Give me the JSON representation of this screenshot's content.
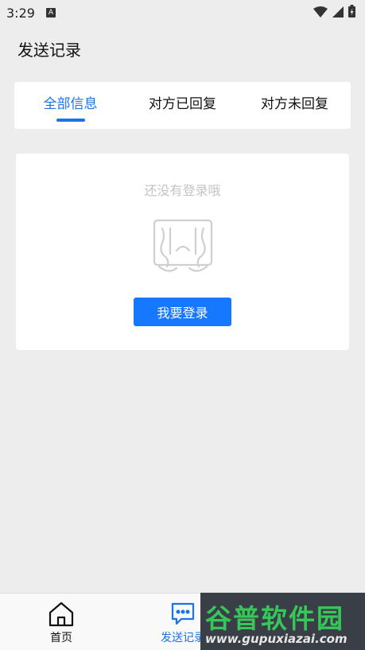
{
  "status_bar": {
    "time": "3:29",
    "notification_glyph": "A",
    "icons": [
      "wifi-icon",
      "cell-signal-icon",
      "battery-icon"
    ]
  },
  "header": {
    "title": "发送记录"
  },
  "tabs": [
    {
      "label": "全部信息",
      "active": true
    },
    {
      "label": "对方已回复",
      "active": false
    },
    {
      "label": "对方未回复",
      "active": false
    }
  ],
  "empty_state": {
    "message": "还没有登录哦",
    "illustration": "crying-face-icon",
    "button_label": "我要登录"
  },
  "bottom_nav": {
    "items": [
      {
        "label": "首页",
        "icon": "home-icon",
        "active": false
      },
      {
        "label": "发送记录",
        "icon": "message-icon",
        "active": true
      }
    ]
  },
  "watermark": {
    "title": "谷普软件园",
    "url": "www.gupuxiazai.com"
  },
  "colors": {
    "accent": "#1a73e8",
    "button": "#1677ff",
    "background": "#ededed",
    "watermark_green": "#35c758"
  }
}
